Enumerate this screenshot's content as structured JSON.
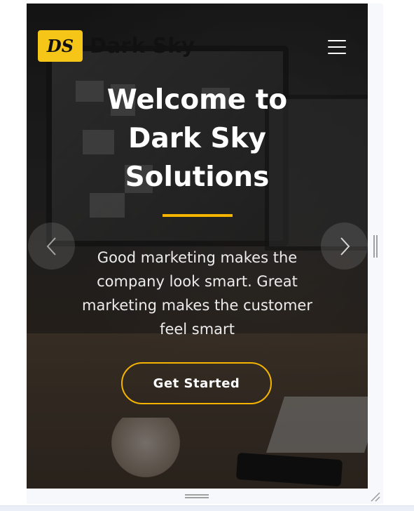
{
  "brand": {
    "logo_mark": "DS",
    "name": "Dark Sky",
    "accent_color": "#f5b400"
  },
  "nav": {
    "menu_icon": "hamburger-menu-icon"
  },
  "hero": {
    "title_line1": "Welcome to",
    "title_line2": "Dark Sky",
    "title_line3": "Solutions",
    "subtext": "Good marketing makes the company look smart. Great marketing makes the customer feel smart",
    "cta_label": "Get Started"
  },
  "carousel": {
    "prev_icon": "chevron-left-icon",
    "next_icon": "chevron-right-icon"
  }
}
